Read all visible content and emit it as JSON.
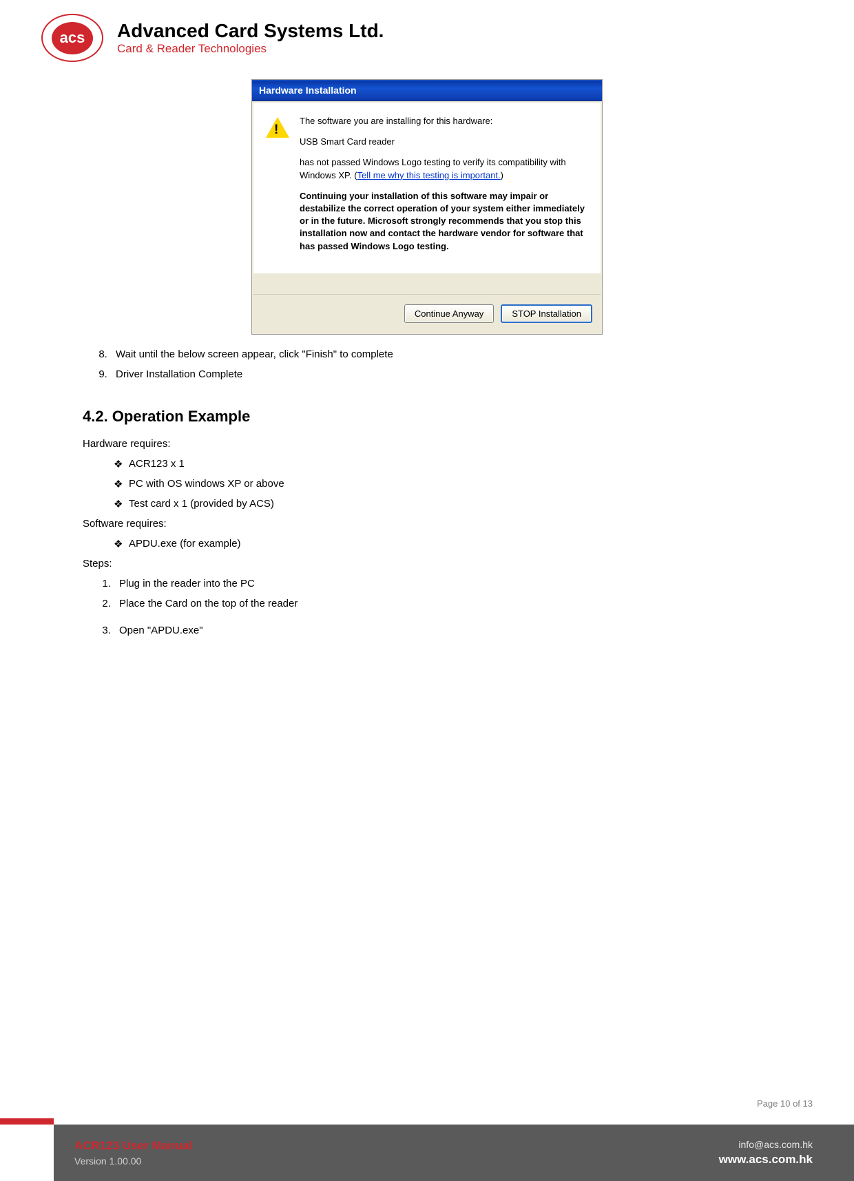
{
  "header": {
    "logo_text": "acs",
    "company_name": "Advanced Card Systems Ltd.",
    "tagline": "Card & Reader Technologies"
  },
  "dialog": {
    "title": "Hardware Installation",
    "line1": "The software you are installing for this hardware:",
    "device": "USB Smart Card reader",
    "line2a": "has not passed Windows Logo testing to verify its compatibility with Windows XP. (",
    "link": "Tell me why this testing is important.",
    "line2b": ")",
    "warning": "Continuing your installation of this software may impair or destabilize the correct operation of your system either immediately or in the future. Microsoft strongly recommends that you stop this installation now and contact the hardware vendor for software that has passed Windows Logo testing.",
    "btn_continue": "Continue Anyway",
    "btn_stop": "STOP Installation"
  },
  "steps_continue": {
    "item8": "Wait until the below screen appear, click \"Finish\" to complete",
    "item9": "Driver Installation Complete"
  },
  "section": {
    "heading": "4.2.   Operation Example",
    "hardware_label": "Hardware requires:",
    "hw": [
      "ACR123 x 1",
      "PC with OS windows XP or above",
      "Test card x 1 (provided by ACS)"
    ],
    "software_label": "Software requires:",
    "sw": [
      "APDU.exe (for example)"
    ],
    "steps_label": "Steps:",
    "steps": [
      "Plug in the reader into the PC",
      "Place the Card on the top of the reader",
      "Open \"APDU.exe\""
    ]
  },
  "footer": {
    "page_label": "Page 10 of 13",
    "manual_title": "ACR123 User Manual",
    "version": "Version 1.00.00",
    "email": "info@acs.com.hk",
    "website": "www.acs.com.hk"
  }
}
